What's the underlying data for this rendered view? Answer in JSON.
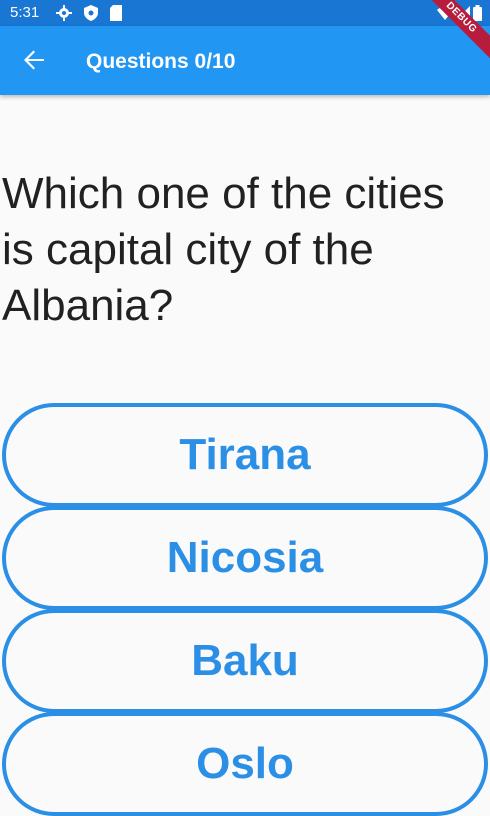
{
  "status_bar": {
    "time": "5:31",
    "debug_label": "DEBUG"
  },
  "app_bar": {
    "title": "Questions 0/10",
    "back_icon": "arrow-left-icon",
    "color": "#2196f3"
  },
  "question": {
    "text": "Which one of the cities is capital city of the Albania?"
  },
  "answers": [
    {
      "label": "Tirana"
    },
    {
      "label": "Nicosia"
    },
    {
      "label": "Baku"
    },
    {
      "label": "Oslo"
    }
  ],
  "colors": {
    "accent": "#2b8fe6",
    "status_bar": "#1976d2",
    "background": "#fafafa"
  }
}
